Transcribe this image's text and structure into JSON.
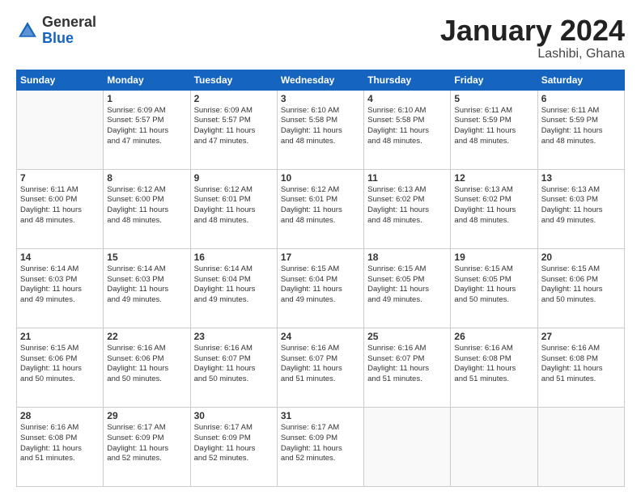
{
  "header": {
    "logo_general": "General",
    "logo_blue": "Blue",
    "month_title": "January 2024",
    "location": "Lashibi, Ghana"
  },
  "weekdays": [
    "Sunday",
    "Monday",
    "Tuesday",
    "Wednesday",
    "Thursday",
    "Friday",
    "Saturday"
  ],
  "weeks": [
    [
      {
        "day": "",
        "info": ""
      },
      {
        "day": "1",
        "info": "Sunrise: 6:09 AM\nSunset: 5:57 PM\nDaylight: 11 hours\nand 47 minutes."
      },
      {
        "day": "2",
        "info": "Sunrise: 6:09 AM\nSunset: 5:57 PM\nDaylight: 11 hours\nand 47 minutes."
      },
      {
        "day": "3",
        "info": "Sunrise: 6:10 AM\nSunset: 5:58 PM\nDaylight: 11 hours\nand 48 minutes."
      },
      {
        "day": "4",
        "info": "Sunrise: 6:10 AM\nSunset: 5:58 PM\nDaylight: 11 hours\nand 48 minutes."
      },
      {
        "day": "5",
        "info": "Sunrise: 6:11 AM\nSunset: 5:59 PM\nDaylight: 11 hours\nand 48 minutes."
      },
      {
        "day": "6",
        "info": "Sunrise: 6:11 AM\nSunset: 5:59 PM\nDaylight: 11 hours\nand 48 minutes."
      }
    ],
    [
      {
        "day": "7",
        "info": "Sunrise: 6:11 AM\nSunset: 6:00 PM\nDaylight: 11 hours\nand 48 minutes."
      },
      {
        "day": "8",
        "info": "Sunrise: 6:12 AM\nSunset: 6:00 PM\nDaylight: 11 hours\nand 48 minutes."
      },
      {
        "day": "9",
        "info": "Sunrise: 6:12 AM\nSunset: 6:01 PM\nDaylight: 11 hours\nand 48 minutes."
      },
      {
        "day": "10",
        "info": "Sunrise: 6:12 AM\nSunset: 6:01 PM\nDaylight: 11 hours\nand 48 minutes."
      },
      {
        "day": "11",
        "info": "Sunrise: 6:13 AM\nSunset: 6:02 PM\nDaylight: 11 hours\nand 48 minutes."
      },
      {
        "day": "12",
        "info": "Sunrise: 6:13 AM\nSunset: 6:02 PM\nDaylight: 11 hours\nand 48 minutes."
      },
      {
        "day": "13",
        "info": "Sunrise: 6:13 AM\nSunset: 6:03 PM\nDaylight: 11 hours\nand 49 minutes."
      }
    ],
    [
      {
        "day": "14",
        "info": "Sunrise: 6:14 AM\nSunset: 6:03 PM\nDaylight: 11 hours\nand 49 minutes."
      },
      {
        "day": "15",
        "info": "Sunrise: 6:14 AM\nSunset: 6:03 PM\nDaylight: 11 hours\nand 49 minutes."
      },
      {
        "day": "16",
        "info": "Sunrise: 6:14 AM\nSunset: 6:04 PM\nDaylight: 11 hours\nand 49 minutes."
      },
      {
        "day": "17",
        "info": "Sunrise: 6:15 AM\nSunset: 6:04 PM\nDaylight: 11 hours\nand 49 minutes."
      },
      {
        "day": "18",
        "info": "Sunrise: 6:15 AM\nSunset: 6:05 PM\nDaylight: 11 hours\nand 49 minutes."
      },
      {
        "day": "19",
        "info": "Sunrise: 6:15 AM\nSunset: 6:05 PM\nDaylight: 11 hours\nand 50 minutes."
      },
      {
        "day": "20",
        "info": "Sunrise: 6:15 AM\nSunset: 6:06 PM\nDaylight: 11 hours\nand 50 minutes."
      }
    ],
    [
      {
        "day": "21",
        "info": "Sunrise: 6:15 AM\nSunset: 6:06 PM\nDaylight: 11 hours\nand 50 minutes."
      },
      {
        "day": "22",
        "info": "Sunrise: 6:16 AM\nSunset: 6:06 PM\nDaylight: 11 hours\nand 50 minutes."
      },
      {
        "day": "23",
        "info": "Sunrise: 6:16 AM\nSunset: 6:07 PM\nDaylight: 11 hours\nand 50 minutes."
      },
      {
        "day": "24",
        "info": "Sunrise: 6:16 AM\nSunset: 6:07 PM\nDaylight: 11 hours\nand 51 minutes."
      },
      {
        "day": "25",
        "info": "Sunrise: 6:16 AM\nSunset: 6:07 PM\nDaylight: 11 hours\nand 51 minutes."
      },
      {
        "day": "26",
        "info": "Sunrise: 6:16 AM\nSunset: 6:08 PM\nDaylight: 11 hours\nand 51 minutes."
      },
      {
        "day": "27",
        "info": "Sunrise: 6:16 AM\nSunset: 6:08 PM\nDaylight: 11 hours\nand 51 minutes."
      }
    ],
    [
      {
        "day": "28",
        "info": "Sunrise: 6:16 AM\nSunset: 6:08 PM\nDaylight: 11 hours\nand 51 minutes."
      },
      {
        "day": "29",
        "info": "Sunrise: 6:17 AM\nSunset: 6:09 PM\nDaylight: 11 hours\nand 52 minutes."
      },
      {
        "day": "30",
        "info": "Sunrise: 6:17 AM\nSunset: 6:09 PM\nDaylight: 11 hours\nand 52 minutes."
      },
      {
        "day": "31",
        "info": "Sunrise: 6:17 AM\nSunset: 6:09 PM\nDaylight: 11 hours\nand 52 minutes."
      },
      {
        "day": "",
        "info": ""
      },
      {
        "day": "",
        "info": ""
      },
      {
        "day": "",
        "info": ""
      }
    ]
  ]
}
